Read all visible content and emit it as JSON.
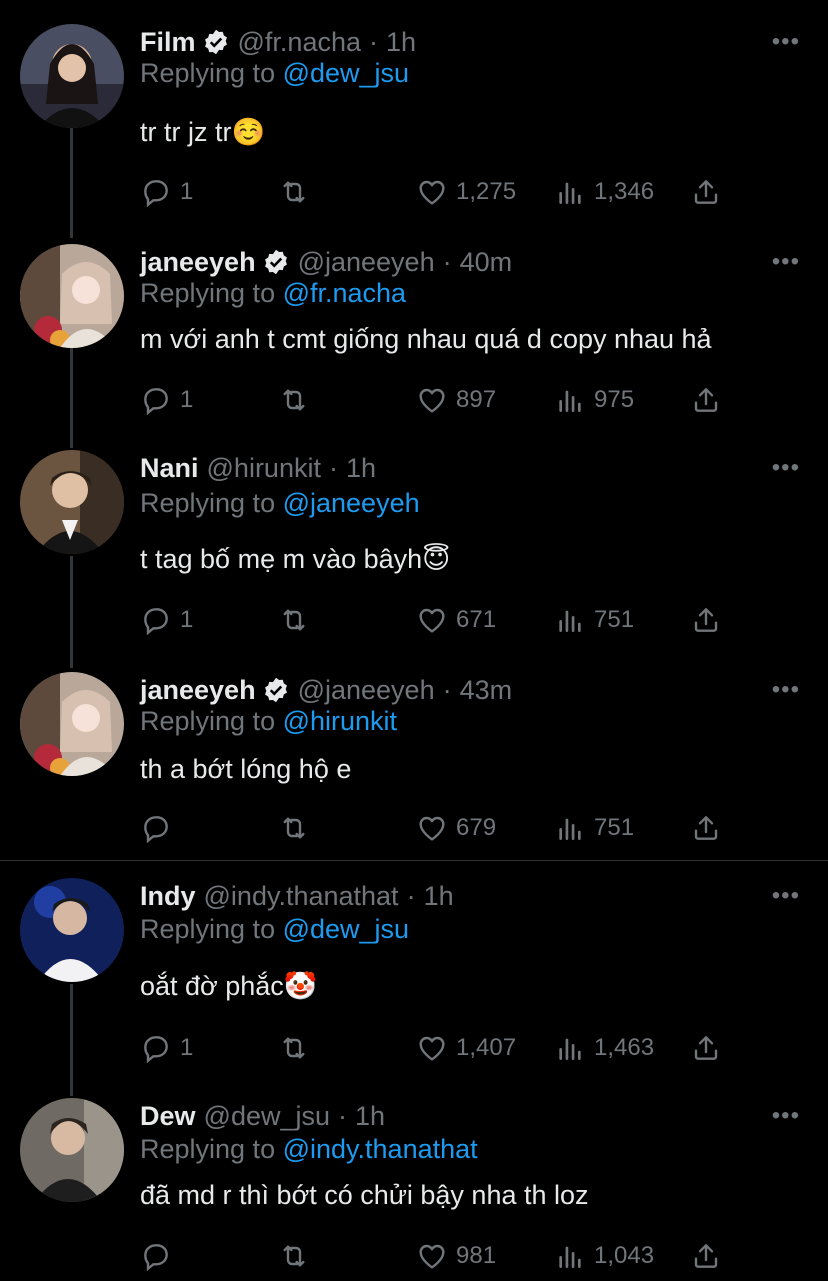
{
  "tweets": [
    {
      "name": "Film",
      "verified": true,
      "handle": "@fr.nacha",
      "time": "1h",
      "reply_prefix": "Replying to ",
      "reply_to": "@dew_jsu",
      "text": "tr tr jz tr☺️",
      "replies": "1",
      "likes": "1,275",
      "views": "1,346"
    },
    {
      "name": "janeeyeh",
      "verified": true,
      "handle": "@janeeyeh",
      "time": "40m",
      "reply_prefix": "Replying to ",
      "reply_to": "@fr.nacha",
      "text": "m với anh t cmt giống nhau quá d copy nhau hả",
      "replies": "1",
      "likes": "897",
      "views": "975"
    },
    {
      "name": "Nani",
      "verified": false,
      "handle": "@hirunkit",
      "time": "1h",
      "reply_prefix": "Replying to ",
      "reply_to": "@janeeyeh",
      "text": "t tag bố mẹ m vào bâyh😇",
      "replies": "1",
      "likes": "671",
      "views": "751"
    },
    {
      "name": "janeeyeh",
      "verified": true,
      "handle": "@janeeyeh",
      "time": "43m",
      "reply_prefix": "Replying to ",
      "reply_to": "@hirunkit",
      "text": "th a bớt lóng hộ e",
      "replies": "",
      "likes": "679",
      "views": "751"
    },
    {
      "name": "Indy",
      "verified": false,
      "handle": "@indy.thanathat",
      "time": "1h",
      "reply_prefix": "Replying to ",
      "reply_to": "@dew_jsu",
      "text": "oắt đờ phắc🤡",
      "replies": "1",
      "likes": "1,407",
      "views": "1,463"
    },
    {
      "name": "Dew",
      "verified": false,
      "handle": "@dew_jsu",
      "time": "1h",
      "reply_prefix": "Replying to ",
      "reply_to": "@indy.thanathat",
      "text": "đã md r thì bớt có chửi bậy nha th loz",
      "replies": "",
      "likes": "981",
      "views": "1,043"
    }
  ],
  "icons": {
    "more": "more-icon",
    "reply": "reply-icon",
    "retweet": "retweet-icon",
    "like": "like-icon",
    "views": "views-icon",
    "share": "share-icon",
    "verified": "verified-badge-icon"
  },
  "colors": {
    "background": "#000000",
    "link": "#1d9bf0",
    "muted": "#71767b",
    "text": "#e7e9ea"
  }
}
